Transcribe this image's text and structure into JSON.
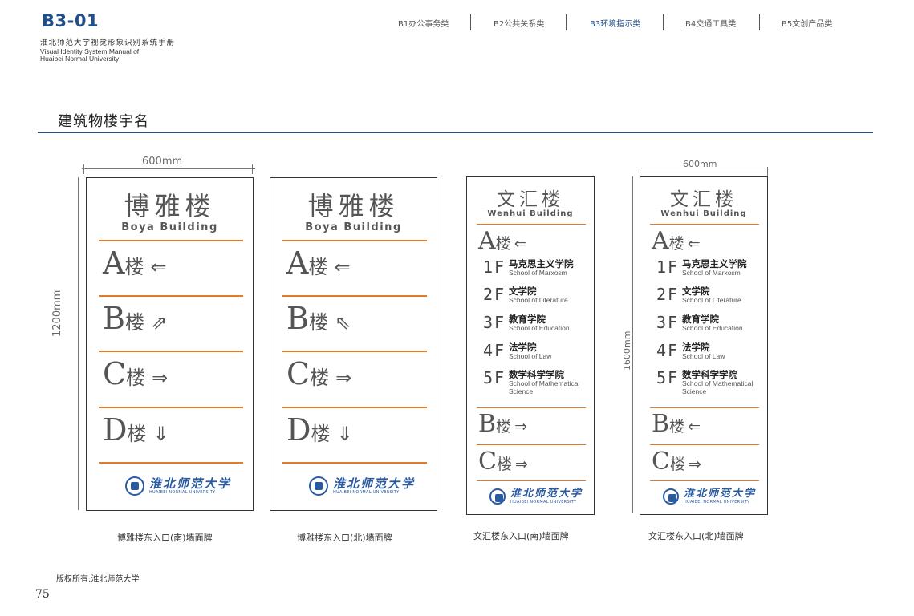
{
  "header": {
    "code": "B3-01",
    "subtitle_cn": "淮北师范大学视觉形象识别系统手册",
    "subtitle_en_1": "Visual Identity System Manual of",
    "subtitle_en_2": "Huaibei Normal University"
  },
  "nav": {
    "items": [
      "B1办公事务类",
      "B2公共关系类",
      "B3环境指示类",
      "B4交通工具类",
      "B5文创产品类"
    ],
    "active_index": 2
  },
  "section_title": "建筑物楼宇名",
  "dims": {
    "width_1": "600mm",
    "height_1": "1200mm",
    "width_2": "600mm",
    "height_2": "1600mm"
  },
  "sign1": {
    "name_cn": "博雅楼",
    "name_en": "Boya Building",
    "rows": [
      {
        "letter": "A",
        "lou": "楼",
        "arrow": "⇐"
      },
      {
        "letter": "B",
        "lou": "楼",
        "arrow": "⇗"
      },
      {
        "letter": "C",
        "lou": "楼",
        "arrow": "⇒"
      },
      {
        "letter": "D",
        "lou": "楼",
        "arrow": "⇓"
      }
    ],
    "caption": "博雅楼东入口(南)墙面牌"
  },
  "sign2": {
    "name_cn": "博雅楼",
    "name_en": "Boya Building",
    "rows": [
      {
        "letter": "A",
        "lou": "楼",
        "arrow": "⇐"
      },
      {
        "letter": "B",
        "lou": "楼",
        "arrow": "⇖"
      },
      {
        "letter": "C",
        "lou": "楼",
        "arrow": "⇒"
      },
      {
        "letter": "D",
        "lou": "楼",
        "arrow": "⇓"
      }
    ],
    "caption": "博雅楼东入口(北)墙面牌"
  },
  "sign3": {
    "name_cn": "文汇楼",
    "name_en": "Wenhui Building",
    "top": {
      "letter": "A",
      "lou": "楼",
      "arrow": "⇐"
    },
    "floors": [
      {
        "num": "1F",
        "cn": "马克思主义学院",
        "en": "School of Marxosm"
      },
      {
        "num": "2F",
        "cn": "文学院",
        "en": "School of Literature"
      },
      {
        "num": "3F",
        "cn": "教育学院",
        "en": "School of Education"
      },
      {
        "num": "4F",
        "cn": "法学院",
        "en": "School of Law"
      },
      {
        "num": "5F",
        "cn": "数学科学学院",
        "en": "School of Mathematical Science"
      }
    ],
    "bottom": [
      {
        "letter": "B",
        "lou": "楼",
        "arrow": "⇒"
      },
      {
        "letter": "C",
        "lou": "楼",
        "arrow": "⇒"
      }
    ],
    "caption": "文汇楼东入口(南)墙面牌"
  },
  "sign4": {
    "name_cn": "文汇楼",
    "name_en": "Wenhui Building",
    "top": {
      "letter": "A",
      "lou": "楼",
      "arrow": "⇐"
    },
    "floors": [
      {
        "num": "1F",
        "cn": "马克思主义学院",
        "en": "School of Marxosm"
      },
      {
        "num": "2F",
        "cn": "文学院",
        "en": "School of Literature"
      },
      {
        "num": "3F",
        "cn": "教育学院",
        "en": "School of Education"
      },
      {
        "num": "4F",
        "cn": "法学院",
        "en": "School of Law"
      },
      {
        "num": "5F",
        "cn": "数学科学学院",
        "en": "School of Mathematical Science"
      }
    ],
    "bottom": [
      {
        "letter": "B",
        "lou": "楼",
        "arrow": "⇐"
      },
      {
        "letter": "C",
        "lou": "楼",
        "arrow": "⇒"
      }
    ],
    "caption": "文汇楼东入口(北)墙面牌"
  },
  "logo": {
    "cn": "淮北师范大学",
    "en": "HUAIBEI NORMAL UNIVERSITY"
  },
  "footer": {
    "copyright": "版权所有:淮北师范大学",
    "page_number": "75"
  },
  "colors": {
    "brand_blue": "#1f4e89",
    "accent_orange": "#e07b27"
  }
}
